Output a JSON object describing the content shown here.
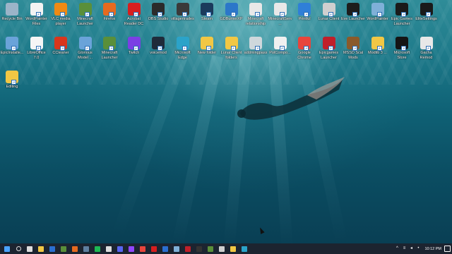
{
  "desktop": {
    "icons": [
      {
        "label": "Recycle Bin",
        "icon": "recycle-bin-icon",
        "color": "#9bb4c8"
      },
      {
        "label": "WordPainter Files",
        "icon": "folder-file-icon",
        "color": "#f3f3f3"
      },
      {
        "label": "VLC media player",
        "icon": "vlc-cone-icon",
        "color": "#f08a14"
      },
      {
        "label": "Minecraft Launcher",
        "icon": "minecraft-grass-icon",
        "color": "#5a8f3a"
      },
      {
        "label": "Firefox",
        "icon": "firefox-icon",
        "color": "#e66a1f"
      },
      {
        "label": "Acrobat Reader DC",
        "icon": "acrobat-icon",
        "color": "#d71e1e"
      },
      {
        "label": "OBS Studio",
        "icon": "obs-icon",
        "color": "#2b2b2b"
      },
      {
        "label": "villagertrades",
        "icon": "document-icon",
        "color": "#3a3a3a"
      },
      {
        "label": "Steam",
        "icon": "steam-icon",
        "color": "#1b3a5c"
      },
      {
        "label": "GDBurnerXP",
        "icon": "disc-burner-icon",
        "color": "#2c77c9"
      },
      {
        "label": "Minecraft relationship",
        "icon": "minecraft-file-icon",
        "color": "#e8e8e8"
      },
      {
        "label": "MinecraftServ...",
        "icon": "server-icon",
        "color": "#e8e8e8"
      },
      {
        "label": "Printful",
        "icon": "printful-icon",
        "color": "#2f7fd8"
      },
      {
        "label": "Lunar Client",
        "icon": "lunar-client-icon",
        "color": "#cfcfcf"
      },
      {
        "label": "Eve Launcher",
        "icon": "eve-icon",
        "color": "#1d1d1d"
      },
      {
        "label": "WordPainter",
        "icon": "wordpainter-icon",
        "color": "#7fb0d8"
      },
      {
        "label": "Epic Games Launcher",
        "icon": "epic-games-icon",
        "color": "#1a1a1a"
      },
      {
        "label": "EliteSettings",
        "icon": "elite-settings-icon",
        "color": "#1a1a1a"
      },
      {
        "label": "EpicInstalle...",
        "icon": "installer-icon",
        "color": "#6aa3d9"
      },
      {
        "label": "LibreOffice 7.0",
        "icon": "libreoffice-icon",
        "color": "#f5f5f5"
      },
      {
        "label": "CCleaner",
        "icon": "ccleaner-icon",
        "color": "#d9361c"
      },
      {
        "label": "Glorious Model ...",
        "icon": "glorious-icon",
        "color": "#6aa3d9"
      },
      {
        "label": "Minecraft Launcher",
        "icon": "minecraft-grass-icon",
        "color": "#5a8f3a"
      },
      {
        "label": "Twitch",
        "icon": "twitch-icon",
        "color": "#7b3fe4"
      },
      {
        "label": "voicemod",
        "icon": "voicemod-icon",
        "color": "#1f2b3a"
      },
      {
        "label": "Microsoft Edge",
        "icon": "edge-icon",
        "color": "#2ba3c9"
      },
      {
        "label": "New folder",
        "icon": "folder-icon",
        "color": "#f2c744"
      },
      {
        "label": "Lunar Client folders",
        "icon": "folder-icon",
        "color": "#f2c744"
      },
      {
        "label": "addmingpass",
        "icon": "image-file-icon",
        "color": "#cfd8dc"
      },
      {
        "label": "PotCompo...",
        "icon": "document-icon",
        "color": "#f0f0f0"
      },
      {
        "label": "Google Chrome",
        "icon": "chrome-icon",
        "color": "#e8453c"
      },
      {
        "label": "Epicgames Launcher",
        "icon": "epicgames-red-icon",
        "color": "#c0202a"
      },
      {
        "label": "MSSD Scal Mods",
        "icon": "crate-icon",
        "color": "#8a5a2b"
      },
      {
        "label": "Modlib 3 ...",
        "icon": "zip-folder-icon",
        "color": "#f2c744"
      },
      {
        "label": "Microsoft Store",
        "icon": "store-icon",
        "color": "#151515"
      },
      {
        "label": "Gacha Remod",
        "icon": "gacha-icon",
        "color": "#e8e8e8"
      },
      {
        "label": "Editing",
        "icon": "notepad-icon",
        "color": "#f2c744"
      }
    ]
  },
  "taskbar": {
    "items": [
      {
        "icon": "windows-start-icon",
        "color": "#4aa3ff"
      },
      {
        "icon": "search-icon",
        "color": "#dddddd"
      },
      {
        "icon": "task-view-icon",
        "color": "#dddddd"
      },
      {
        "icon": "file-explorer-icon",
        "color": "#f2c744"
      },
      {
        "icon": "store-icon",
        "color": "#2b6fd1"
      },
      {
        "icon": "minecraft-icon",
        "color": "#5a8f3a"
      },
      {
        "icon": "firefox-icon",
        "color": "#e66a1f"
      },
      {
        "icon": "steam-icon",
        "color": "#5f7fa0"
      },
      {
        "icon": "spotify-icon",
        "color": "#1db954"
      },
      {
        "icon": "obs-icon",
        "color": "#dddddd"
      },
      {
        "icon": "discord-icon",
        "color": "#5865f2"
      },
      {
        "icon": "twitch-icon",
        "color": "#9146ff"
      },
      {
        "icon": "chrome-icon",
        "color": "#e8453c"
      },
      {
        "icon": "acrobat-icon",
        "color": "#d71e1e"
      },
      {
        "icon": "mail-icon",
        "color": "#2b6fd1"
      },
      {
        "icon": "app-icon",
        "color": "#7fb0d8"
      },
      {
        "icon": "app-icon",
        "color": "#c0202a"
      },
      {
        "icon": "app-icon",
        "color": "#333333"
      },
      {
        "icon": "app-icon",
        "color": "#5a8f3a"
      },
      {
        "icon": "app-icon",
        "color": "#cfcfcf"
      },
      {
        "icon": "app-icon",
        "color": "#f2c744"
      },
      {
        "icon": "app-icon",
        "color": "#2ba3c9"
      }
    ],
    "tray_icons": [
      "chevron-up-icon",
      "network-icon",
      "volume-icon",
      "language-icon"
    ],
    "clock": "10:12 PM"
  }
}
